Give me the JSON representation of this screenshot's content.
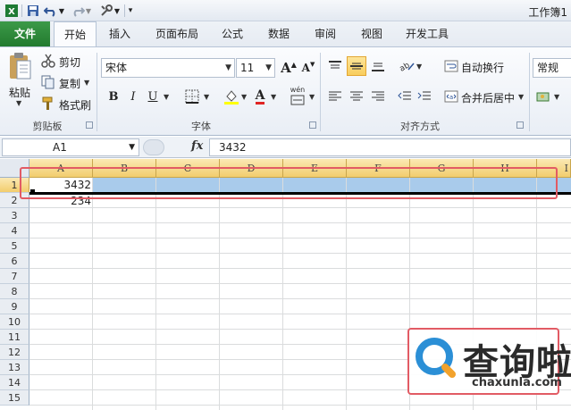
{
  "titlebar": {
    "title": "工作簿1"
  },
  "tabs": {
    "file": "文件",
    "items": [
      "开始",
      "插入",
      "页面布局",
      "公式",
      "数据",
      "审阅",
      "视图",
      "开发工具"
    ]
  },
  "clipboard": {
    "paste": "粘贴",
    "cut": "剪切",
    "copy": "复制",
    "format_painter": "格式刷",
    "label": "剪贴板"
  },
  "font": {
    "name": "宋体",
    "size": "11",
    "label": "字体",
    "bold": "B",
    "italic": "I",
    "underline": "U",
    "grow": "A",
    "shrink": "A",
    "color_letter": "A",
    "phonetic": "wén"
  },
  "alignment": {
    "wrap_text": "自动换行",
    "merge_center": "合并后居中",
    "label": "对齐方式"
  },
  "number": {
    "format": "常规"
  },
  "formula_bar": {
    "name_box": "A1",
    "fx": "fx",
    "value": "3432"
  },
  "grid": {
    "columns": [
      "A",
      "B",
      "C",
      "D",
      "E",
      "F",
      "G",
      "H",
      "I"
    ],
    "rows": [
      "1",
      "2",
      "3",
      "4",
      "5",
      "6",
      "7",
      "8",
      "9",
      "10",
      "11",
      "12",
      "13",
      "14",
      "15"
    ],
    "cells": {
      "A1": "3432",
      "A2": "234"
    }
  },
  "watermark": {
    "brand": "查询啦",
    "domain": "chaxunla.com"
  },
  "colors": {
    "accent": "#227a2f",
    "selection": "#a9cbeb",
    "header_highlight": "#f2cd6d",
    "annotation_red": "#e25b64",
    "font_color": "#e02424",
    "highlight_color": "#ffff00"
  }
}
